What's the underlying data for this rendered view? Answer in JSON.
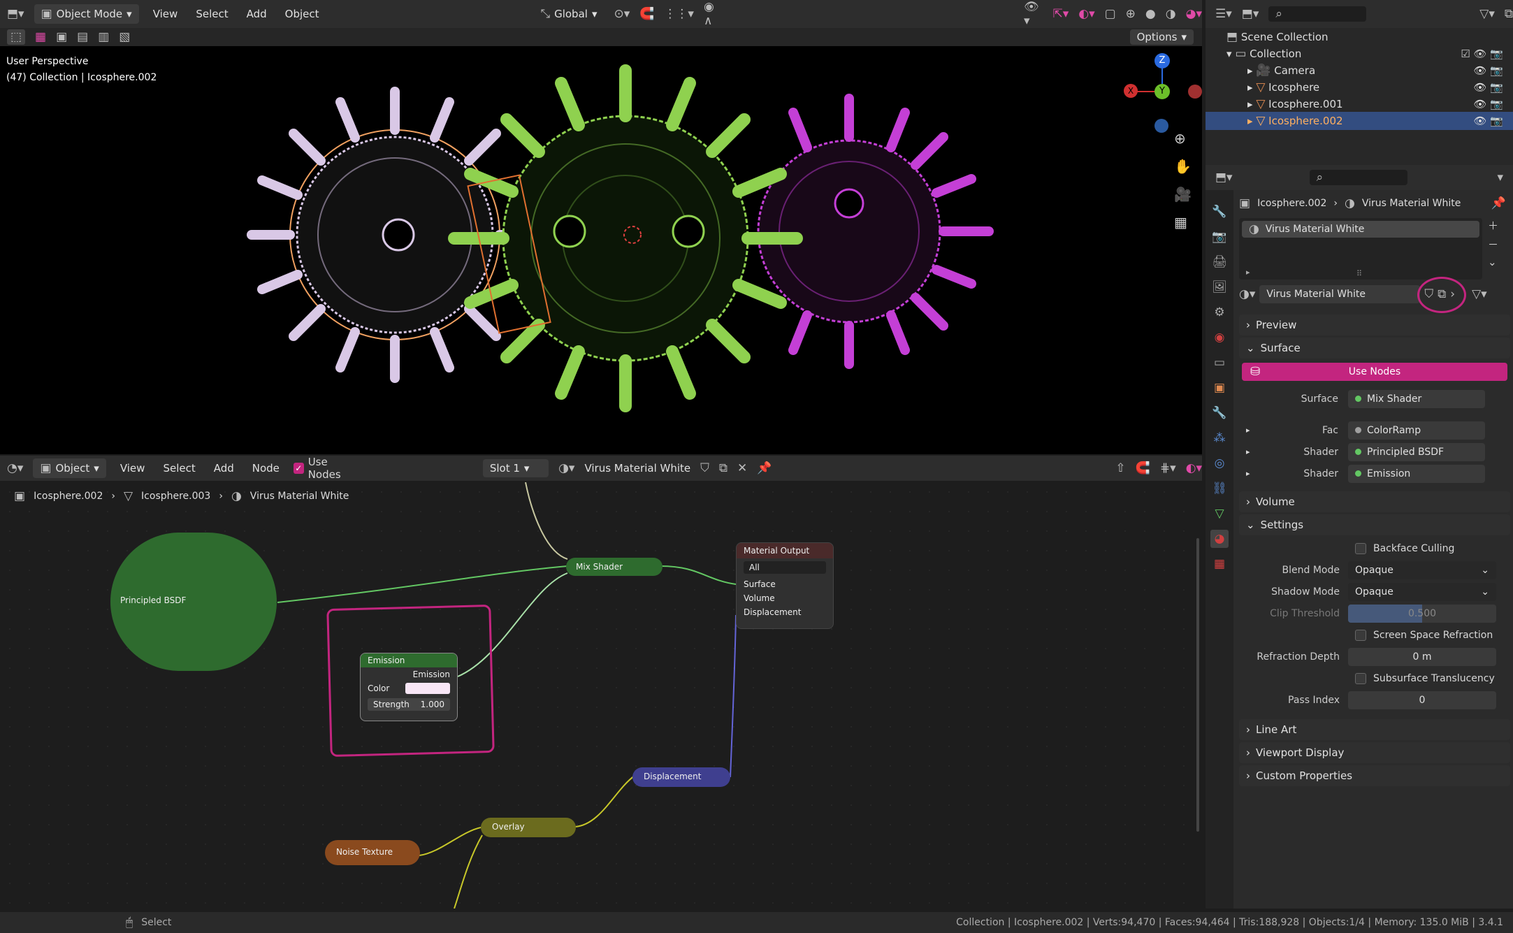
{
  "viewport_header": {
    "mode": "Object Mode",
    "menus": [
      "View",
      "Select",
      "Add",
      "Object"
    ],
    "transform": "Global",
    "options": "Options"
  },
  "viewport": {
    "perspective": "User Perspective",
    "collection_info": "(47) Collection | Icosphere.002",
    "gizmo_axes": [
      "Z",
      "Y",
      "X"
    ]
  },
  "outliner": {
    "scene_collection": "Scene Collection",
    "collection": "Collection",
    "items": [
      "Camera",
      "Icosphere",
      "Icosphere.001",
      "Icosphere.002"
    ],
    "selected": "Icosphere.002"
  },
  "properties": {
    "breadcrumb_object": "Icosphere.002",
    "breadcrumb_material": "Virus Material  White",
    "slot_name": "Virus Material  White",
    "material_name": "Virus Material  White",
    "sections": {
      "preview": "Preview",
      "surface": "Surface",
      "volume": "Volume",
      "settings": "Settings",
      "line_art": "Line Art",
      "viewport_display": "Viewport Display",
      "custom_properties": "Custom Properties"
    },
    "use_nodes": "Use Nodes",
    "surface_rows": [
      {
        "label": "Surface",
        "value": "Mix Shader"
      },
      {
        "label": "Fac",
        "value": "ColorRamp"
      },
      {
        "label": "Shader",
        "value": "Principled BSDF"
      },
      {
        "label": "Shader",
        "value": "Emission"
      }
    ],
    "settings": {
      "backface_culling": "Backface Culling",
      "blend_mode_label": "Blend Mode",
      "blend_mode": "Opaque",
      "shadow_mode_label": "Shadow Mode",
      "shadow_mode": "Opaque",
      "clip_threshold_label": "Clip Threshold",
      "clip_threshold": "0.500",
      "screen_space_refraction": "Screen Space Refraction",
      "refraction_depth_label": "Refraction Depth",
      "refraction_depth": "0 m",
      "subsurface_translucency": "Subsurface Translucency",
      "pass_index_label": "Pass Index",
      "pass_index": "0"
    }
  },
  "node_header": {
    "editor": "Object",
    "menus": [
      "View",
      "Select",
      "Add",
      "Node"
    ],
    "use_nodes": "Use Nodes",
    "slot": "Slot 1",
    "material": "Virus Material  White",
    "breadcrumb": [
      "Icosphere.002",
      "Icosphere.003",
      "Virus Material  White"
    ]
  },
  "nodes": {
    "principled": "Principled BSDF",
    "mix_shader": "Mix Shader",
    "material_output": "Material Output",
    "output_target": "All",
    "output_sockets": [
      "Surface",
      "Volume",
      "Displacement"
    ],
    "emission": "Emission",
    "emission_out": "Emission",
    "emission_color": "Color",
    "emission_strength_label": "Strength",
    "emission_strength": "1.000",
    "displacement": "Displacement",
    "overlay": "Overlay",
    "noise": "Noise Texture"
  },
  "status_bar": {
    "select": "Select",
    "info": "Collection | Icosphere.002 | Verts:94,470 | Faces:94,464 | Tris:188,928 | Objects:1/4 | Memory: 135.0 MiB | 3.4.1"
  },
  "colors": {
    "accent_pink": "#c3257f",
    "selection_blue": "#334d80",
    "node_green": "#2e6b2e",
    "virus_white": "#d9c8e6",
    "virus_green": "#8fd14f",
    "virus_purple": "#c43fd6",
    "outline_orange": "#f0a060"
  }
}
